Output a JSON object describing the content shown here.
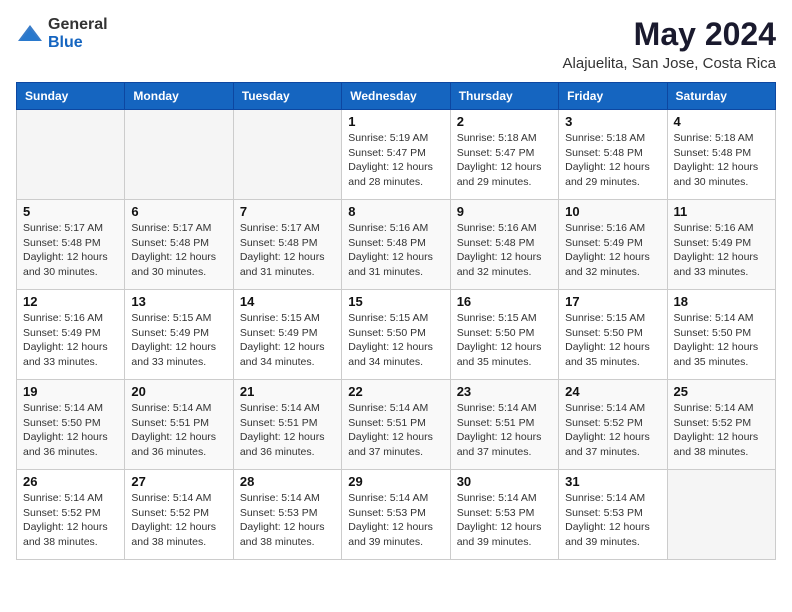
{
  "logo": {
    "general": "General",
    "blue": "Blue"
  },
  "title": "May 2024",
  "subtitle": "Alajuelita, San Jose, Costa Rica",
  "days_of_week": [
    "Sunday",
    "Monday",
    "Tuesday",
    "Wednesday",
    "Thursday",
    "Friday",
    "Saturday"
  ],
  "weeks": [
    [
      {
        "day": "",
        "info": ""
      },
      {
        "day": "",
        "info": ""
      },
      {
        "day": "",
        "info": ""
      },
      {
        "day": "1",
        "info": "Sunrise: 5:19 AM\nSunset: 5:47 PM\nDaylight: 12 hours and 28 minutes."
      },
      {
        "day": "2",
        "info": "Sunrise: 5:18 AM\nSunset: 5:47 PM\nDaylight: 12 hours and 29 minutes."
      },
      {
        "day": "3",
        "info": "Sunrise: 5:18 AM\nSunset: 5:48 PM\nDaylight: 12 hours and 29 minutes."
      },
      {
        "day": "4",
        "info": "Sunrise: 5:18 AM\nSunset: 5:48 PM\nDaylight: 12 hours and 30 minutes."
      }
    ],
    [
      {
        "day": "5",
        "info": "Sunrise: 5:17 AM\nSunset: 5:48 PM\nDaylight: 12 hours and 30 minutes."
      },
      {
        "day": "6",
        "info": "Sunrise: 5:17 AM\nSunset: 5:48 PM\nDaylight: 12 hours and 30 minutes."
      },
      {
        "day": "7",
        "info": "Sunrise: 5:17 AM\nSunset: 5:48 PM\nDaylight: 12 hours and 31 minutes."
      },
      {
        "day": "8",
        "info": "Sunrise: 5:16 AM\nSunset: 5:48 PM\nDaylight: 12 hours and 31 minutes."
      },
      {
        "day": "9",
        "info": "Sunrise: 5:16 AM\nSunset: 5:48 PM\nDaylight: 12 hours and 32 minutes."
      },
      {
        "day": "10",
        "info": "Sunrise: 5:16 AM\nSunset: 5:49 PM\nDaylight: 12 hours and 32 minutes."
      },
      {
        "day": "11",
        "info": "Sunrise: 5:16 AM\nSunset: 5:49 PM\nDaylight: 12 hours and 33 minutes."
      }
    ],
    [
      {
        "day": "12",
        "info": "Sunrise: 5:16 AM\nSunset: 5:49 PM\nDaylight: 12 hours and 33 minutes."
      },
      {
        "day": "13",
        "info": "Sunrise: 5:15 AM\nSunset: 5:49 PM\nDaylight: 12 hours and 33 minutes."
      },
      {
        "day": "14",
        "info": "Sunrise: 5:15 AM\nSunset: 5:49 PM\nDaylight: 12 hours and 34 minutes."
      },
      {
        "day": "15",
        "info": "Sunrise: 5:15 AM\nSunset: 5:50 PM\nDaylight: 12 hours and 34 minutes."
      },
      {
        "day": "16",
        "info": "Sunrise: 5:15 AM\nSunset: 5:50 PM\nDaylight: 12 hours and 35 minutes."
      },
      {
        "day": "17",
        "info": "Sunrise: 5:15 AM\nSunset: 5:50 PM\nDaylight: 12 hours and 35 minutes."
      },
      {
        "day": "18",
        "info": "Sunrise: 5:14 AM\nSunset: 5:50 PM\nDaylight: 12 hours and 35 minutes."
      }
    ],
    [
      {
        "day": "19",
        "info": "Sunrise: 5:14 AM\nSunset: 5:50 PM\nDaylight: 12 hours and 36 minutes."
      },
      {
        "day": "20",
        "info": "Sunrise: 5:14 AM\nSunset: 5:51 PM\nDaylight: 12 hours and 36 minutes."
      },
      {
        "day": "21",
        "info": "Sunrise: 5:14 AM\nSunset: 5:51 PM\nDaylight: 12 hours and 36 minutes."
      },
      {
        "day": "22",
        "info": "Sunrise: 5:14 AM\nSunset: 5:51 PM\nDaylight: 12 hours and 37 minutes."
      },
      {
        "day": "23",
        "info": "Sunrise: 5:14 AM\nSunset: 5:51 PM\nDaylight: 12 hours and 37 minutes."
      },
      {
        "day": "24",
        "info": "Sunrise: 5:14 AM\nSunset: 5:52 PM\nDaylight: 12 hours and 37 minutes."
      },
      {
        "day": "25",
        "info": "Sunrise: 5:14 AM\nSunset: 5:52 PM\nDaylight: 12 hours and 38 minutes."
      }
    ],
    [
      {
        "day": "26",
        "info": "Sunrise: 5:14 AM\nSunset: 5:52 PM\nDaylight: 12 hours and 38 minutes."
      },
      {
        "day": "27",
        "info": "Sunrise: 5:14 AM\nSunset: 5:52 PM\nDaylight: 12 hours and 38 minutes."
      },
      {
        "day": "28",
        "info": "Sunrise: 5:14 AM\nSunset: 5:53 PM\nDaylight: 12 hours and 38 minutes."
      },
      {
        "day": "29",
        "info": "Sunrise: 5:14 AM\nSunset: 5:53 PM\nDaylight: 12 hours and 39 minutes."
      },
      {
        "day": "30",
        "info": "Sunrise: 5:14 AM\nSunset: 5:53 PM\nDaylight: 12 hours and 39 minutes."
      },
      {
        "day": "31",
        "info": "Sunrise: 5:14 AM\nSunset: 5:53 PM\nDaylight: 12 hours and 39 minutes."
      },
      {
        "day": "",
        "info": ""
      }
    ]
  ]
}
